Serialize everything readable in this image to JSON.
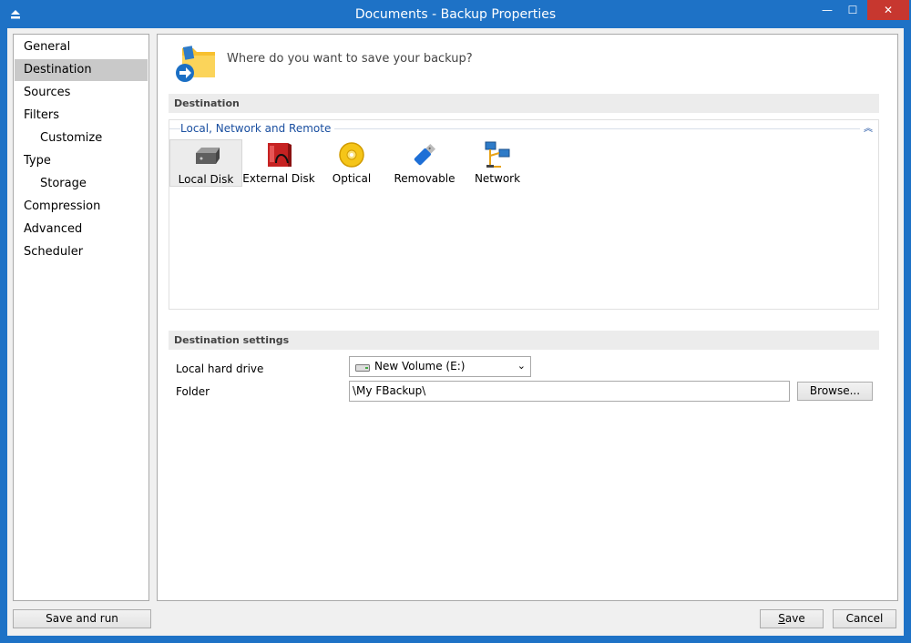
{
  "window": {
    "title": "Documents - Backup Properties",
    "minimize_glyph": "—",
    "maximize_glyph": "☐",
    "close_glyph": "✕"
  },
  "sidebar": {
    "items": [
      {
        "label": "General"
      },
      {
        "label": "Destination",
        "active": true
      },
      {
        "label": "Sources"
      },
      {
        "label": "Filters"
      },
      {
        "label": "Customize",
        "sub": true
      },
      {
        "label": "Type"
      },
      {
        "label": "Storage",
        "sub": true
      },
      {
        "label": "Compression"
      },
      {
        "label": "Advanced"
      },
      {
        "label": "Scheduler"
      }
    ]
  },
  "main": {
    "header_text": "Where do you want to save your backup?",
    "destination_section": "Destination",
    "group_title": "Local, Network and Remote",
    "group_collapse_glyph": "︽",
    "destinations": [
      {
        "label": "Local Disk",
        "icon": "local-disk-icon",
        "selected": true
      },
      {
        "label": "External Disk",
        "icon": "external-disk-icon"
      },
      {
        "label": "Optical",
        "icon": "optical-disc-icon"
      },
      {
        "label": "Removable",
        "icon": "usb-drive-icon"
      },
      {
        "label": "Network",
        "icon": "network-icon"
      }
    ],
    "settings_section": "Destination settings",
    "local_hard_drive_label": "Local hard drive",
    "local_hard_drive_value": "New Volume (E:)",
    "folder_label": "Folder",
    "folder_value": "\\My FBackup\\",
    "browse_label": "Browse..."
  },
  "footer": {
    "save_and_run_label": "Save and run",
    "save_label_prefix": "",
    "save_label_underlined": "S",
    "save_label_rest": "ave",
    "cancel_label": "Cancel"
  },
  "colors": {
    "titlebar": "#1e72c6",
    "close_button": "#c7372f",
    "selected_nav": "#c9c9c9",
    "group_title": "#1a4fa0"
  }
}
